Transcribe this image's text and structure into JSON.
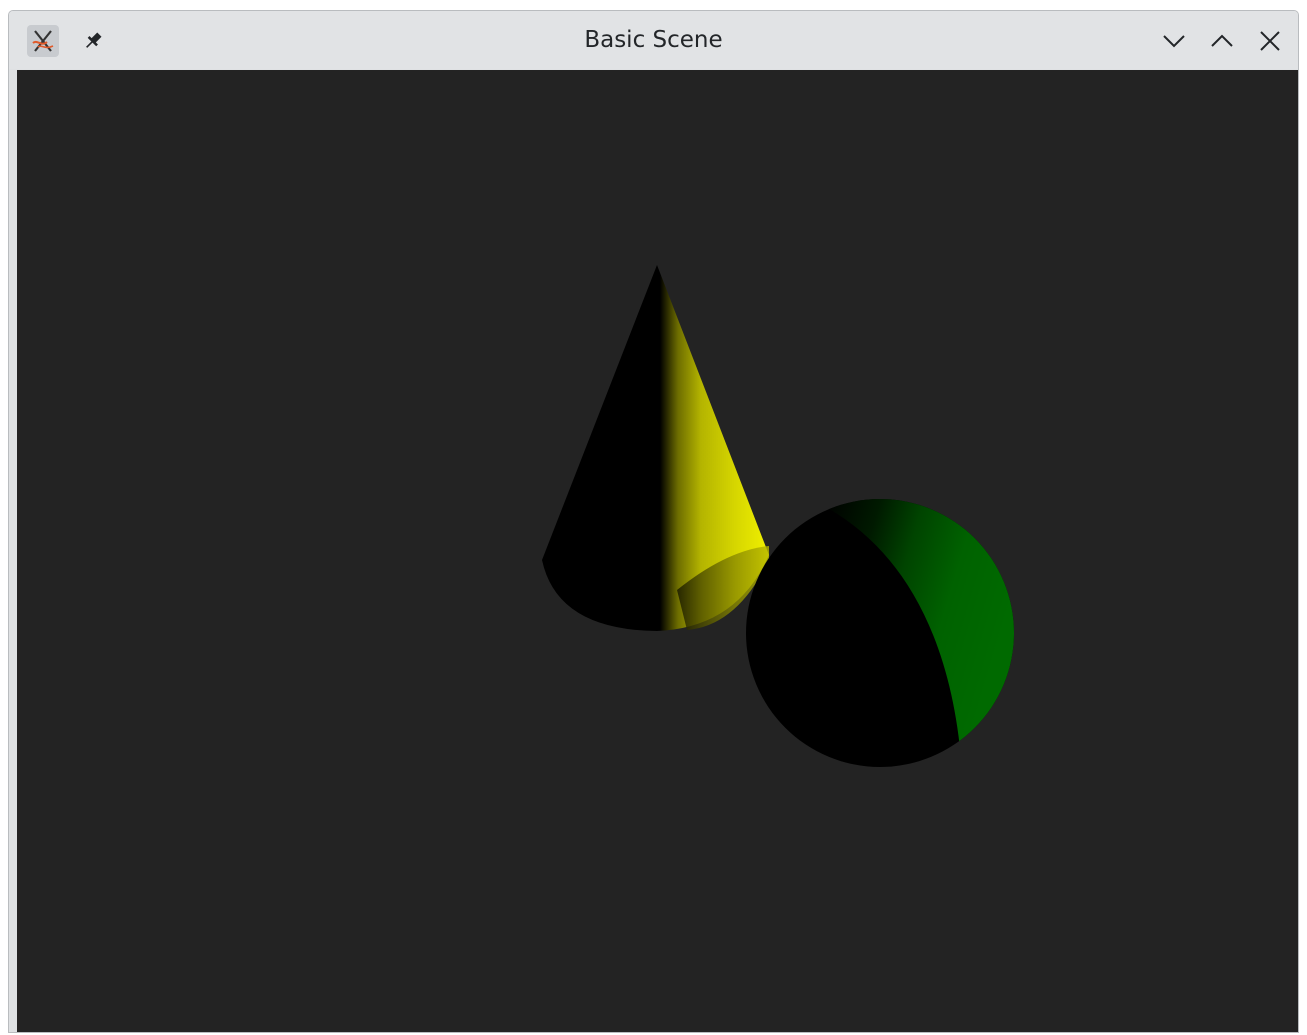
{
  "window": {
    "title": "Basic Scene"
  },
  "titlebar": {
    "app_icon": "x-app-icon",
    "pin_icon": "pin-icon",
    "controls": {
      "minimize_icon": "chevron-down-icon",
      "maximize_icon": "chevron-up-icon",
      "close_icon": "close-icon"
    }
  },
  "scene": {
    "background": "#232323",
    "objects": [
      {
        "name": "cone",
        "color": "#e5e500"
      },
      {
        "name": "sphere",
        "color": "#006600"
      }
    ]
  }
}
